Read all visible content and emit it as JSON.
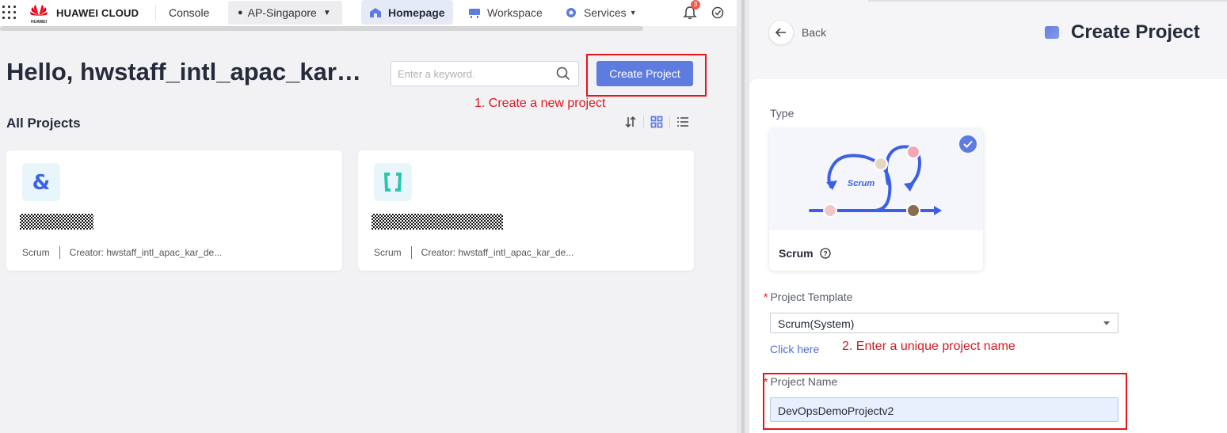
{
  "topbar": {
    "brand": "HUAWEI CLOUD",
    "logo_caption": "HUAWEI",
    "console": "Console",
    "region": "AP-Singapore",
    "tabs": [
      {
        "label": "Homepage",
        "active": true
      },
      {
        "label": "Workspace",
        "active": false
      },
      {
        "label": "Services",
        "active": false
      }
    ],
    "notification_count": "3"
  },
  "main": {
    "greeting": "Hello, hwstaff_intl_apac_kar…",
    "search_placeholder": "Enter a keyword.",
    "create_button": "Create Project",
    "annotation_1": "1. Create a new project",
    "section_title": "All Projects",
    "projects": [
      {
        "type": "Scrum",
        "creator": "Creator: hwstaff_intl_apac_kar_de...",
        "icon": "ampersand-icon"
      },
      {
        "type": "Scrum",
        "creator": "Creator: hwstaff_intl_apac_kar_de...",
        "icon": "brackets-icon"
      }
    ]
  },
  "panel": {
    "back_label": "Back",
    "title": "Create Project",
    "type_label": "Type",
    "type_option": "Scrum",
    "illustration_text": "Scrum",
    "template_label": "Project Template",
    "template_value": "Scrum(System)",
    "click_here": "Click here",
    "annotation_2": "2. Enter a unique project name",
    "name_label": "Project Name",
    "name_value": "DevOpsDemoProjectv2",
    "required_mark": "*"
  },
  "colors": {
    "accent": "#5e7ce0",
    "annotation": "#d71920",
    "link": "#526ecc"
  }
}
